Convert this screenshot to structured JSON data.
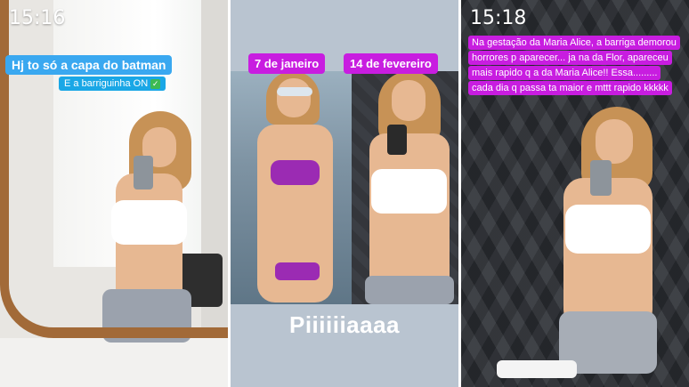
{
  "panels": [
    {
      "time": "15:16",
      "caption_main": "Hj to só a capa do batman",
      "caption_sub": "E a barriguinha ON",
      "caption_sub_icon": "check-emoji-icon"
    },
    {
      "tag_left": "7 de janeiro",
      "tag_right": "14 de fevereiro",
      "bottom_text": "Piiiiiiaaaa"
    },
    {
      "time": "15:18",
      "caption": "Na gestação da Maria Alice, a barriga demorou horrores p aparecer... ja na da Flor, apareceu mais rapido q a da Maria Alice!! Essa......... cada dia q passa ta maior e mttt rapido kkkkk"
    }
  ],
  "colors": {
    "caption_blue": "#3aa8f0",
    "tag_magenta": "#c81de0",
    "mirror_frame": "#a26a38"
  }
}
